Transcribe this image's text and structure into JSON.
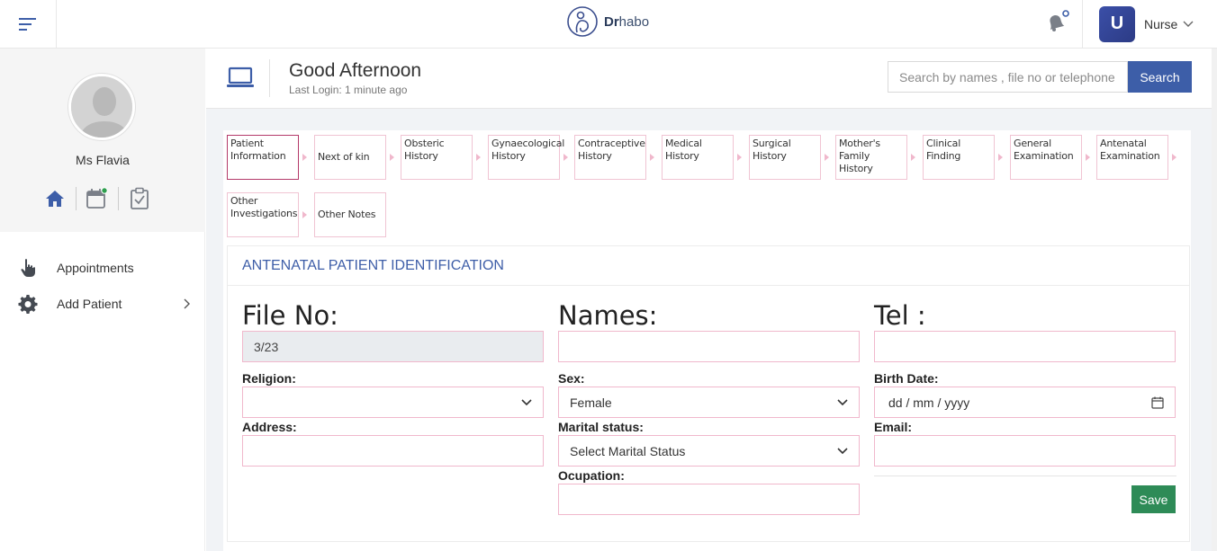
{
  "header": {
    "brand_bold": "Dr",
    "brand_rest": "habo",
    "user_initial": "U",
    "user_role": "Nurse"
  },
  "sidebar": {
    "profile_name": "Ms Flavia",
    "nav": [
      {
        "label": "Appointments",
        "icon": "hand-pointer-icon"
      },
      {
        "label": "Add Patient",
        "icon": "gear-icon"
      }
    ]
  },
  "greeting": {
    "title": "Good Afternoon",
    "subtitle": "Last Login: 1 minute ago"
  },
  "search": {
    "placeholder": "Search by names , file no or telephone",
    "button": "Search"
  },
  "steps": [
    "Patient Information",
    "Next of kin",
    "Obsteric History",
    "Gynaecological History",
    "Contraceptive History",
    "Medical History",
    "Surgical History",
    "Mother's Family History",
    "Clinical Finding",
    "General Examination",
    "Antenatal Examination",
    "Other Investigations",
    "Other Notes"
  ],
  "form": {
    "heading": "ANTENATAL PATIENT IDENTIFICATION",
    "file_no_label": "File No:",
    "file_no_value": "3/23",
    "names_label": "Names:",
    "tel_label": "Tel :",
    "religion_label": "Religion:",
    "religion_value": "",
    "sex_label": "Sex:",
    "sex_value": "Female",
    "birth_label": "Birth Date:",
    "birth_placeholder": "dd / mm / yyyy",
    "address_label": "Address:",
    "marital_label": "Marital status:",
    "marital_value": "Select Marital Status",
    "email_label": "Email:",
    "occupation_label": "Ocupation:",
    "save_button": "Save"
  },
  "colors": {
    "accent": "#3d5ea8",
    "step_border": "#f0c4d3",
    "step_active": "#b43a6a",
    "save": "#2e8b57"
  }
}
